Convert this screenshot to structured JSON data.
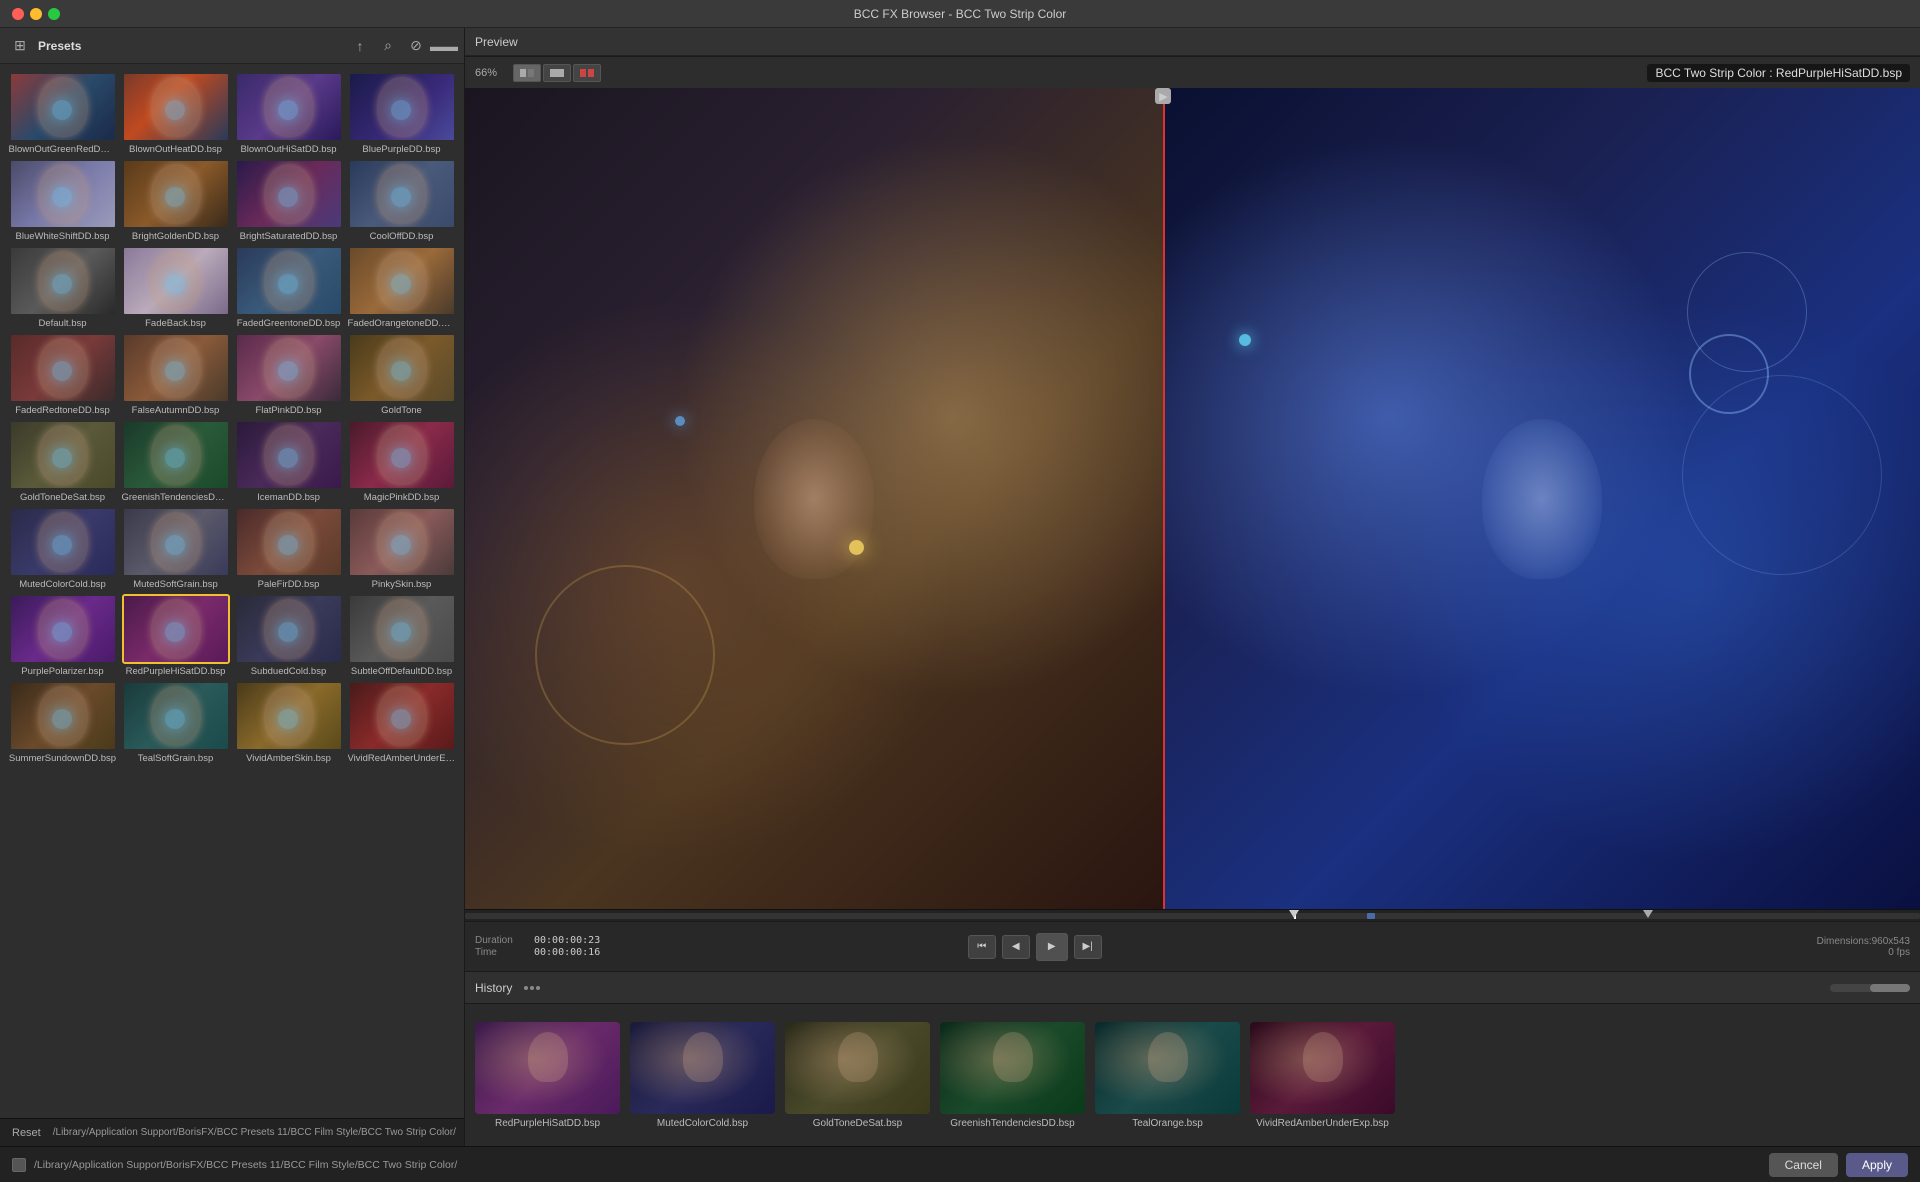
{
  "window": {
    "title": "BCC FX Browser - BCC Two Strip Color"
  },
  "left_panel": {
    "header": {
      "label": "Presets"
    },
    "presets": [
      {
        "name": "BlownOutGreenRedDD.bsp",
        "thumb_class": "thumb-blownoutgreen"
      },
      {
        "name": "BlownOutHeatDD.bsp",
        "thumb_class": "thumb-blownoutheat"
      },
      {
        "name": "BlownOutHiSatDD.bsp",
        "thumb_class": "thumb-blownouthi"
      },
      {
        "name": "BluePurpleDD.bsp",
        "thumb_class": "thumb-bluepurple"
      },
      {
        "name": "BlueWhiteShiftDD.bsp",
        "thumb_class": "thumb-bluewhite"
      },
      {
        "name": "BrightGoldenDD.bsp",
        "thumb_class": "thumb-brightgolden"
      },
      {
        "name": "BrightSaturatedDD.bsp",
        "thumb_class": "thumb-brightsaturated"
      },
      {
        "name": "CoolOffDD.bsp",
        "thumb_class": "thumb-cooloff"
      },
      {
        "name": "Default.bsp",
        "thumb_class": "thumb-default"
      },
      {
        "name": "FadeBack.bsp",
        "thumb_class": "thumb-fadeback"
      },
      {
        "name": "FadedGreentoneDD.bsp",
        "thumb_class": "thumb-fadedgreen"
      },
      {
        "name": "FadedOrangetoneDD.bsp",
        "thumb_class": "thumb-fadedorange"
      },
      {
        "name": "FadedRedtoneDD.bsp",
        "thumb_class": "thumb-fadedred"
      },
      {
        "name": "FalseAutumnDD.bsp",
        "thumb_class": "thumb-falseautumn"
      },
      {
        "name": "FlatPinkDD.bsp",
        "thumb_class": "thumb-flatpink"
      },
      {
        "name": "GoldTone",
        "thumb_class": "thumb-goldtone"
      },
      {
        "name": "GoldToneDeSat.bsp",
        "thumb_class": "thumb-goldtonedesat"
      },
      {
        "name": "GreenishTendenciesDD.bsp",
        "thumb_class": "thumb-greenish"
      },
      {
        "name": "IcemanDD.bsp",
        "thumb_class": "thumb-iceman"
      },
      {
        "name": "MagicPinkDD.bsp",
        "thumb_class": "thumb-magicpink"
      },
      {
        "name": "MutedColorCold.bsp",
        "thumb_class": "thumb-mutedcolorcold"
      },
      {
        "name": "MutedSoftGrain.bsp",
        "thumb_class": "thumb-mutedsoftgrain"
      },
      {
        "name": "PaleFirDD.bsp",
        "thumb_class": "thumb-palefire"
      },
      {
        "name": "PinkySkin.bsp",
        "thumb_class": "thumb-pinkyskin"
      },
      {
        "name": "PurplePolarizer.bsp",
        "thumb_class": "thumb-purplepolarizer"
      },
      {
        "name": "RedPurpleHiSatDD.bsp",
        "thumb_class": "thumb-redpurple",
        "selected": true
      },
      {
        "name": "SubduedCold.bsp",
        "thumb_class": "thumb-subduedcold"
      },
      {
        "name": "SubtleOffDefaultDD.bsp",
        "thumb_class": "thumb-subtleoff"
      },
      {
        "name": "SummerSundownDD.bsp",
        "thumb_class": "thumb-summersundown"
      },
      {
        "name": "TealSoftGrain.bsp",
        "thumb_class": "thumb-tealsoft"
      },
      {
        "name": "VividAmberSkin.bsp",
        "thumb_class": "thumb-vividamber"
      },
      {
        "name": "VividRedAmberUnderExp.bsp",
        "thumb_class": "thumb-vividred"
      }
    ],
    "path": "/Library/Application Support/BorisFX/BCC Presets 11/BCC Film Style/BCC Two Strip Color/",
    "reset_label": "Reset"
  },
  "right_panel": {
    "preview": {
      "label": "Preview",
      "zoom": "66%",
      "title": "BCC Two Strip Color : RedPurpleHiSatDD.bsp"
    },
    "timeline": {
      "duration_label": "Duration",
      "time_label": "Time",
      "duration_val": "00:00:00:23",
      "time_val": "00:00:00:16",
      "dimensions": "Dimensions:960x543",
      "fps": "0 fps"
    },
    "history": {
      "label": "History",
      "items": [
        {
          "name": "RedPurpleHiSatDD.bsp",
          "thumb_class": "h-thumb-redpurple"
        },
        {
          "name": "MutedColorCold.bsp",
          "thumb_class": "h-thumb-mutedcold"
        },
        {
          "name": "GoldToneDeSat.bsp",
          "thumb_class": "h-thumb-goldtone"
        },
        {
          "name": "GreenishTendenciesDD.bsp",
          "thumb_class": "h-thumb-greenish"
        },
        {
          "name": "TealOrange.bsp",
          "thumb_class": "h-thumb-teal"
        },
        {
          "name": "VividRedAmberUnderExp.bsp",
          "thumb_class": "h-thumb-vividred"
        }
      ]
    }
  },
  "bottom_bar": {
    "cancel_label": "Cancel",
    "apply_label": "Apply"
  }
}
